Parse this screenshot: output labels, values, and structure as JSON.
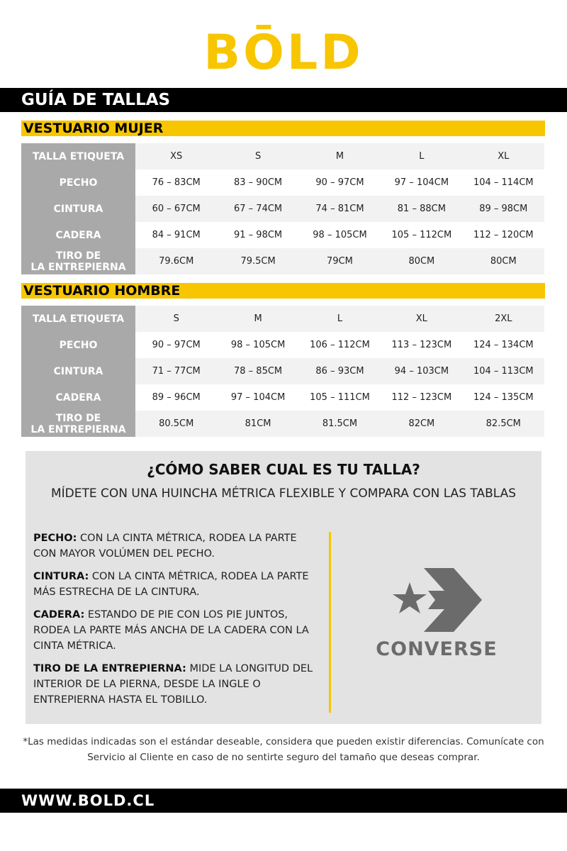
{
  "logo": {
    "text": "BŌLD"
  },
  "title": "GUÍA DE TALLAS",
  "women": {
    "section_title": "VESTUARIO MUJER",
    "rows": [
      {
        "label": "TALLA ETIQUETA",
        "values": [
          "XS",
          "S",
          "M",
          "L",
          "XL"
        ]
      },
      {
        "label": "PECHO",
        "values": [
          "76 – 83CM",
          "83 – 90CM",
          "90 – 97CM",
          "97 – 104CM",
          "104 – 114CM"
        ]
      },
      {
        "label": "CINTURA",
        "values": [
          "60 – 67CM",
          "67 – 74CM",
          "74 – 81CM",
          "81 – 88CM",
          "89 – 98CM"
        ]
      },
      {
        "label": "CADERA",
        "values": [
          "84 – 91CM",
          "91 – 98CM",
          "98 – 105CM",
          "105 – 112CM",
          "112 – 120CM"
        ]
      },
      {
        "label_line1": "TIRO DE",
        "label_line2": "LA ENTREPIERNA",
        "values": [
          "79.6CM",
          "79.5CM",
          "79CM",
          "80CM",
          "80CM"
        ]
      }
    ]
  },
  "men": {
    "section_title": "VESTUARIO HOMBRE",
    "rows": [
      {
        "label": "TALLA ETIQUETA",
        "values": [
          "S",
          "M",
          "L",
          "XL",
          "2XL"
        ]
      },
      {
        "label": "PECHO",
        "values": [
          "90 – 97CM",
          "98 – 105CM",
          "106 – 112CM",
          "113 – 123CM",
          "124 – 134CM"
        ]
      },
      {
        "label": "CINTURA",
        "values": [
          "71 – 77CM",
          "78 – 85CM",
          "86 – 93CM",
          "94 – 103CM",
          "104 – 113CM"
        ]
      },
      {
        "label": "CADERA",
        "values": [
          "89 – 96CM",
          "97 – 104CM",
          "105 – 111CM",
          "112 – 123CM",
          "124 – 135CM"
        ]
      },
      {
        "label_line1": "TIRO DE",
        "label_line2": "LA ENTREPIERNA",
        "values": [
          "80.5CM",
          "81CM",
          "81.5CM",
          "82CM",
          "82.5CM"
        ]
      }
    ]
  },
  "howto": {
    "title": "¿CÓMO SABER CUAL ES TU TALLA?",
    "subtitle": "MÍDETE CON UNA HUINCHA MÉTRICA FLEXIBLE Y COMPARA CON LAS TABLAS",
    "definitions": [
      {
        "term": "PECHO:",
        "text": "CON LA CINTA MÉTRICA, RODEA LA PARTE CON MAYOR VOLÚMEN DEL PECHO."
      },
      {
        "term": "CINTURA:",
        "text": "CON LA CINTA MÉTRICA, RODEA LA PARTE MÁS ESTRECHA DE LA CINTURA."
      },
      {
        "term": "CADERA:",
        "text": "ESTANDO DE PIE CON LOS PIE JUNTOS, RODEA LA PARTE MÁS ANCHA DE LA CADERA CON LA CINTA MÉTRICA."
      },
      {
        "term": "TIRO DE LA ENTREPIERNA:",
        "text": "MIDE LA LONGITUD DEL INTERIOR DE LA PIERNA, DESDE LA INGLE O ENTREPIERNA HASTA EL TOBILLO."
      }
    ],
    "brand_name": "CONVERSE",
    "brand_icon": "converse-star-chevron-icon"
  },
  "disclaimer": "*Las medidas indicadas son el estándar deseable, considera que pueden existir diferencias. Comunícate con Servicio al Cliente en caso de no sentirte seguro del tamaño que deseas comprar.",
  "footer": {
    "url": "WWW.BOLD.CL"
  },
  "colors": {
    "accent": "#f7c600",
    "header_bg": "#000000",
    "row_header_bg": "#a9a9a9",
    "panel_bg": "#e3e3e3",
    "brand_gray": "#6b6b6b"
  }
}
